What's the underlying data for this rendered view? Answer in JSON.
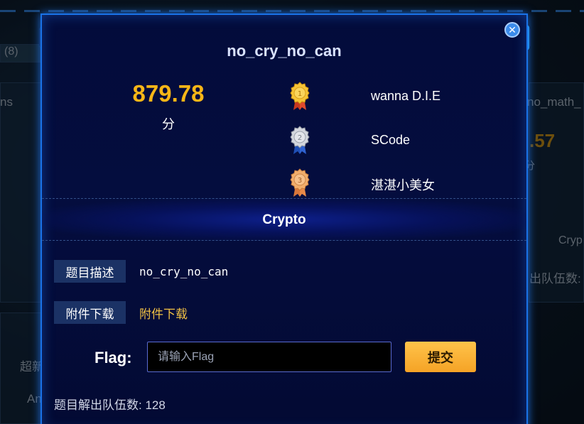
{
  "background": {
    "tab_count": "(8)",
    "left_fragment": "ns",
    "right_title_fragment": "no_math_",
    "right_score_fragment": ".57",
    "right_unit_fragment": "分",
    "right_category_fragment": "Cryp",
    "right_solves_fragment": "出队伍数:",
    "left_lower_fragment_1": "超新",
    "left_lower_fragment_2": "An"
  },
  "modal": {
    "title": "no_cry_no_can",
    "score": "879.78",
    "score_unit": "分",
    "ranks": [
      {
        "place": "1",
        "name": "wanna D.I.E",
        "medal": "gold-medal-icon",
        "color": "#f2b81d"
      },
      {
        "place": "2",
        "name": "SCode",
        "medal": "silver-medal-icon",
        "color": "#c9ccd3"
      },
      {
        "place": "3",
        "name": "湛湛小美女",
        "medal": "bronze-medal-icon",
        "color": "#f0a05a"
      }
    ],
    "category": "Crypto",
    "description_label": "题目描述",
    "description_value": "no_cry_no_can",
    "attachment_label": "附件下载",
    "attachment_link": "附件下载",
    "flag_label": "Flag:",
    "flag_placeholder": "请输入Flag",
    "submit_label": "提交",
    "solves_text": "题目解出队伍数:  128"
  },
  "colors": {
    "accent_blue": "#1a73e8",
    "score_gold": "#f8b617",
    "link_gold": "#f3c244",
    "button_orange": "#f5a326"
  }
}
